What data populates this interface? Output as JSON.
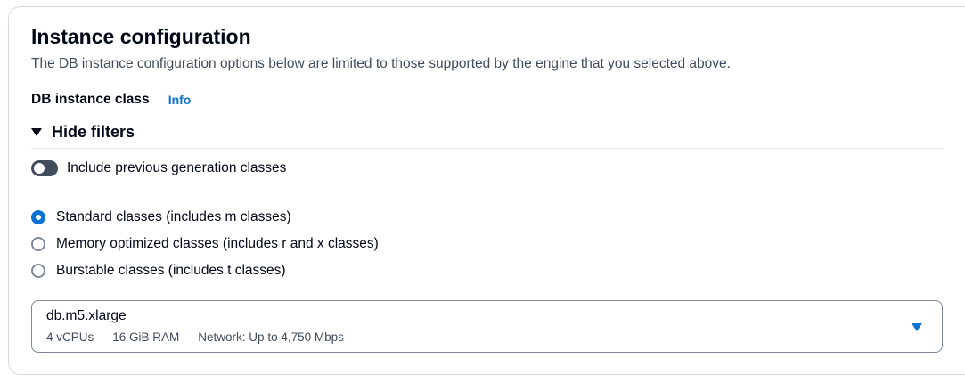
{
  "section": {
    "title": "Instance configuration",
    "description": "The DB instance configuration options below are limited to those supported by the engine that you selected above."
  },
  "instance_class": {
    "label": "DB instance class",
    "info_link": "Info"
  },
  "filters": {
    "toggle_label": "Hide filters",
    "expanded": true,
    "previous_generation": {
      "label": "Include previous generation classes",
      "enabled": false
    },
    "class_options": [
      {
        "label": "Standard classes (includes m classes)",
        "selected": true
      },
      {
        "label": "Memory optimized classes (includes r and x classes)",
        "selected": false
      },
      {
        "label": "Burstable classes (includes t classes)",
        "selected": false
      }
    ]
  },
  "select": {
    "value": "db.m5.xlarge",
    "details": [
      "4 vCPUs",
      "16 GiB RAM",
      "Network: Up to 4,750 Mbps"
    ],
    "icon": "caret-down-icon"
  },
  "colors": {
    "accent": "#0972d3",
    "text": "#000716",
    "secondary_text": "#414d5c",
    "border": "#7d8998"
  }
}
